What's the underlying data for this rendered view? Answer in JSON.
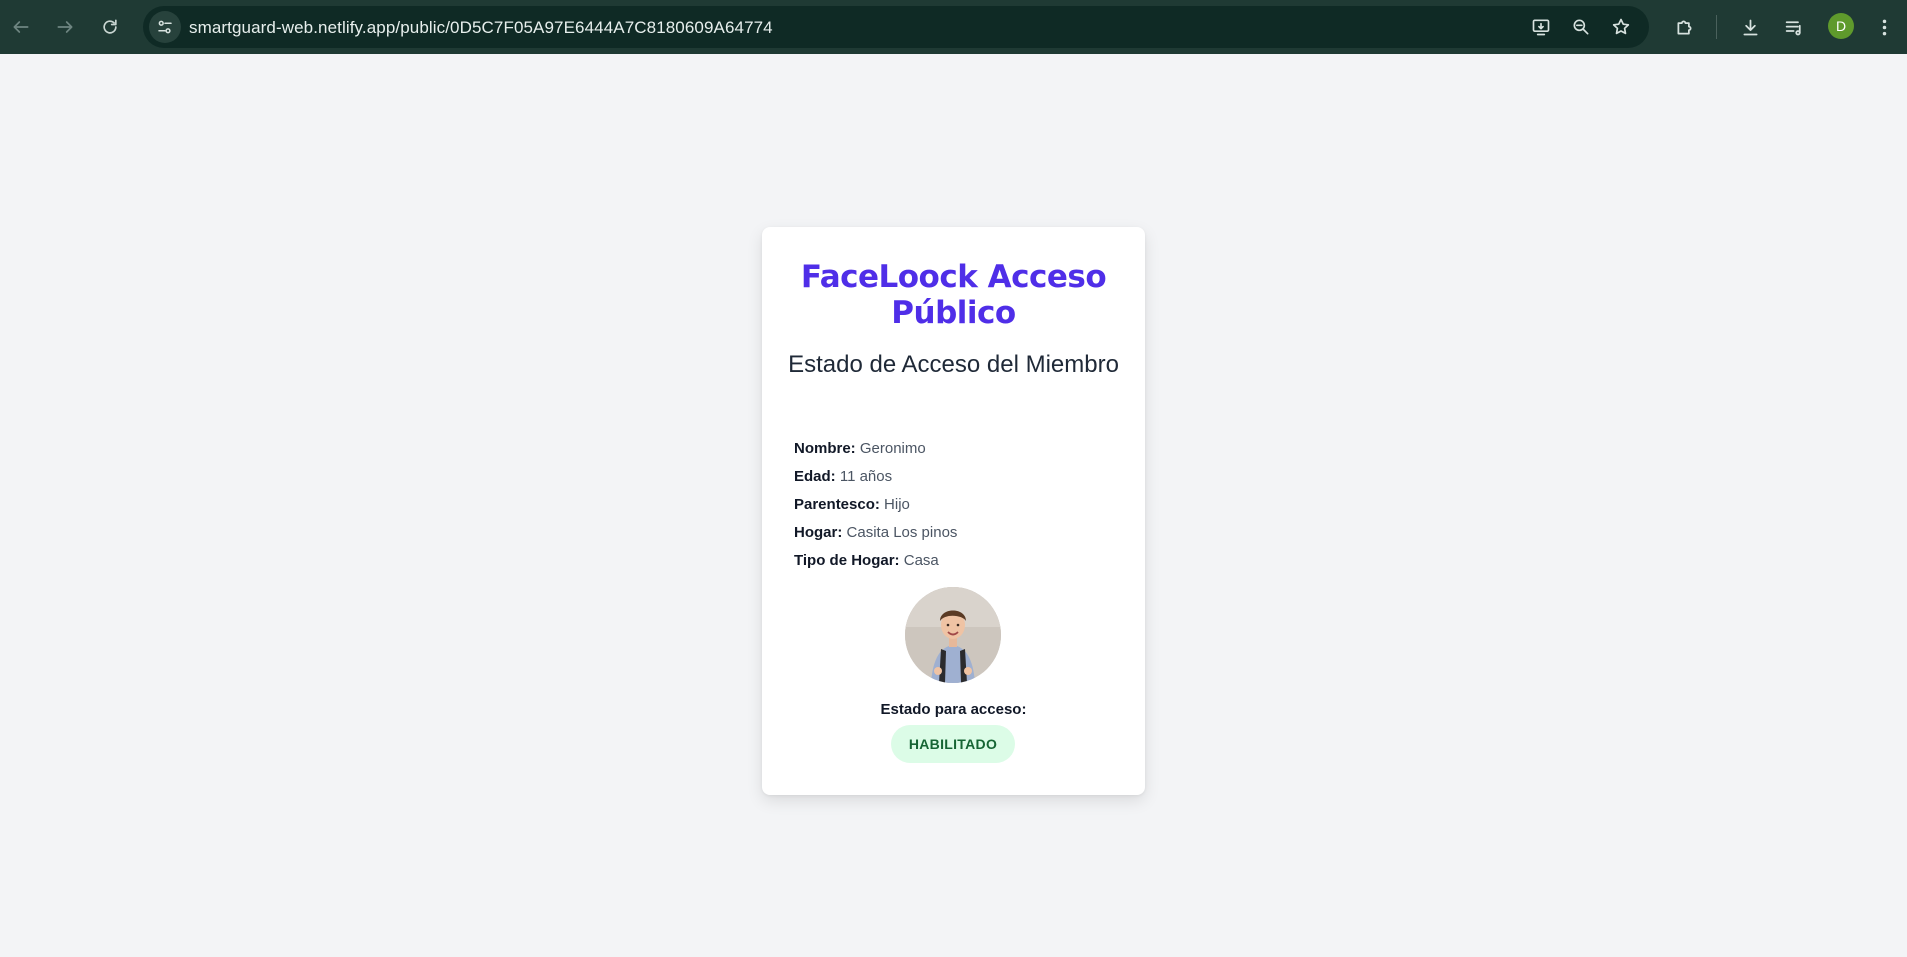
{
  "browser": {
    "url": "smartguard-web.netlify.app/public/0D5C7F05A97E6444A7C8180609A64774",
    "profile_initial": "D",
    "icons": {
      "back": "arrow-left-icon",
      "forward": "arrow-right-icon",
      "reload": "reload-icon",
      "site_info": "tune-icon",
      "install": "install-app-icon",
      "zoom": "zoom-out-icon",
      "bookmark": "star-icon",
      "extensions": "puzzle-icon",
      "downloads": "download-icon",
      "media": "playlist-icon",
      "menu": "kebab-menu-icon"
    },
    "colors": {
      "toolbar": "#1f3a34",
      "omnibox": "#0f2a25",
      "avatar": "#5f9a2c"
    }
  },
  "card": {
    "title": "FaceLoock Acceso Público",
    "subtitle": "Estado de Acceso del Miembro",
    "fields": [
      {
        "label": "Nombre:",
        "value": "Geronimo"
      },
      {
        "label": "Edad:",
        "value": "11 años"
      },
      {
        "label": "Parentesco:",
        "value": "Hijo"
      },
      {
        "label": "Hogar:",
        "value": "Casita Los pinos"
      },
      {
        "label": "Tipo de Hogar:",
        "value": "Casa"
      }
    ],
    "status_label": "Estado para acceso:",
    "status_value": "HABILITADO",
    "colors": {
      "title": "#4f2ee8",
      "badge_bg": "#dcfce7",
      "badge_text": "#166534",
      "page_bg": "#f3f4f6"
    }
  }
}
